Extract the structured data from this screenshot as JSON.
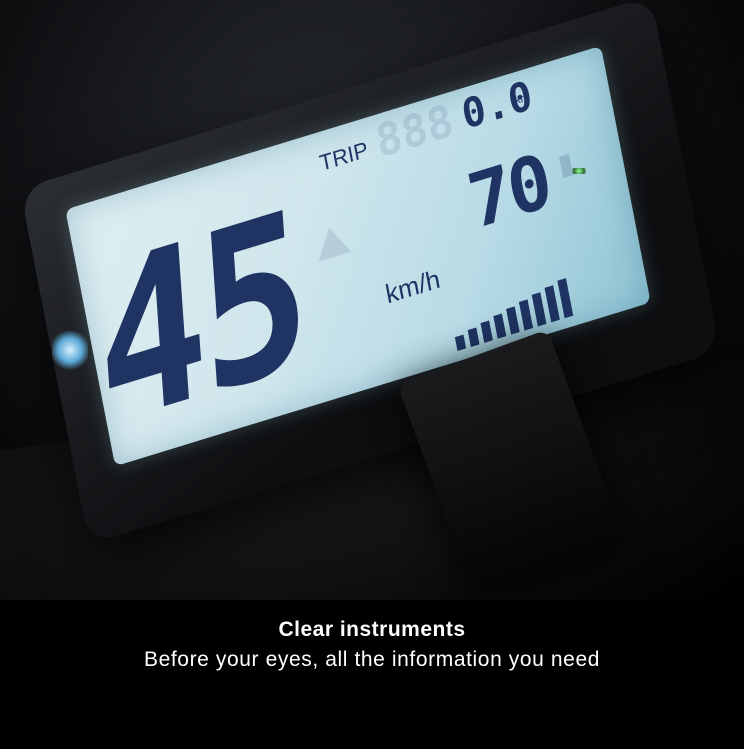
{
  "display": {
    "speed": "45",
    "speed_unit": "km/h",
    "trip_label": "TRIP",
    "trip_value": "0.0",
    "trip_unit": "km",
    "battery_value": "70",
    "battery_bars": 9
  },
  "caption": {
    "title": "Clear instruments",
    "subtitle": "Before your eyes, all the information you need"
  }
}
